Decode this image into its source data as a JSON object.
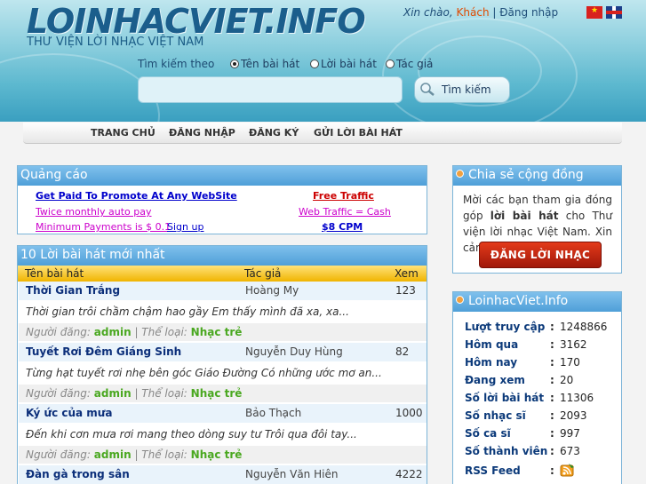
{
  "header": {
    "logo": "LOINHACVIET.INFO",
    "tagline": "THƯ VIỆN LỜI NHẠC VIỆT NAM",
    "greeting": "Xin chào,",
    "guest": "Khách",
    "separator": "|",
    "login": "Đăng nhập",
    "flags": [
      "vietnam-flag-icon",
      "uk-flag-icon"
    ]
  },
  "search": {
    "label": "Tìm kiếm theo",
    "options": [
      {
        "label": "Tên bài hát",
        "selected": true
      },
      {
        "label": "Lời bài hát",
        "selected": false
      },
      {
        "label": "Tác giả",
        "selected": false
      }
    ],
    "value": "",
    "button": "Tìm kiếm"
  },
  "nav": [
    "TRANG CHỦ",
    "ĐĂNG NHẬP",
    "ĐĂNG KÝ",
    "GỬI LỜI BÀI HÁT"
  ],
  "ads": {
    "title": "Quảng cáo",
    "links": [
      "Get Paid To Promote At Any WebSite",
      "Free Traffic",
      "Twice monthly auto pay",
      "Web Traffic = Cash",
      "Minimum Payments is $ 0.1",
      "Sign up",
      "$8 CPM"
    ]
  },
  "songs": {
    "title": "10 Lời bài hát mới nhất",
    "columns": [
      "Tên bài hát",
      "Tác giả",
      "Xem"
    ],
    "poster_label": "Người đăng:",
    "genre_label": "Thể loại:",
    "items": [
      {
        "title": "Thời Gian Trắng",
        "author": "Hoàng My",
        "views": "123",
        "lyric": "Thời gian trôi chầm chậm hao gầy Em thấy mình đã xa, xa...",
        "poster": "admin",
        "genre": "Nhạc trẻ"
      },
      {
        "title": "Tuyết Rơi Đêm Giáng Sinh",
        "author": "Nguyễn Duy Hùng",
        "views": "82",
        "lyric": "Từng hạt tuyết rơi nhẹ bên góc Giáo Đường Có những ước mơ an...",
        "poster": "admin",
        "genre": "Nhạc trẻ"
      },
      {
        "title": "Ký ức của mưa",
        "author": "Bảo Thạch",
        "views": "1000",
        "lyric": "Đến khi cơn mưa rơi mang theo dòng suy tư Trôi qua đôi tay...",
        "poster": "admin",
        "genre": "Nhạc trẻ"
      },
      {
        "title": "Đàn gà trong sân",
        "author": "Nguyễn Văn Hiên",
        "views": "4222"
      }
    ]
  },
  "share": {
    "title": "Chia sẻ cộng đồng",
    "text_before": "Mời các bạn tham gia đóng góp ",
    "text_bold": "lời bài hát",
    "text_after": " cho Thư viện lời nhạc Việt Nam. Xin cảm ơn!",
    "button": "ĐĂNG LỜI NHẠC"
  },
  "stats": {
    "title": "LoinhacViet.Info",
    "colon": ":",
    "rows": [
      {
        "label": "Lượt truy cập",
        "value": "1248866"
      },
      {
        "label": "Hôm qua",
        "value": "3162"
      },
      {
        "label": "Hôm nay",
        "value": "170"
      },
      {
        "label": "Đang xem",
        "value": "20"
      },
      {
        "label": "Số lời bài hát",
        "value": "11306"
      },
      {
        "label": "Số nhạc sĩ",
        "value": "2093"
      },
      {
        "label": "Số ca sĩ",
        "value": "997"
      },
      {
        "label": "Số thành viên",
        "value": "673"
      }
    ],
    "rss_label": "RSS Feed",
    "rss_icon": "rss-feed-icon"
  },
  "colors": {
    "header_top": "#bfe6ee",
    "header_bottom": "#3a9fc0",
    "panel_title": "#4f9fd8",
    "table_header": "#f0b400",
    "link_blue": "#0000cc",
    "link_red": "#cc0000",
    "link_magenta": "#cc00cc",
    "accent_green": "#4aa820",
    "guest_orange": "#e04a00"
  }
}
